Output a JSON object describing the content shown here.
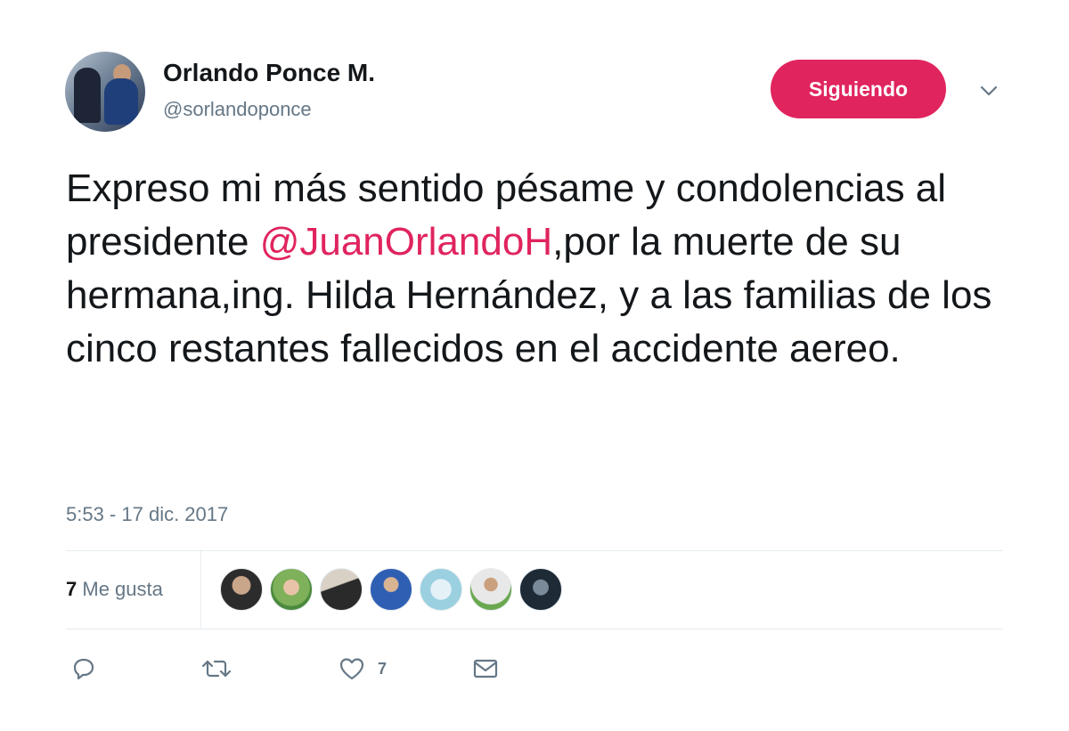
{
  "author": {
    "name": "Orlando Ponce M.",
    "handle": "@sorlandoponce",
    "avatar_icon": "avatar-photo"
  },
  "follow_button": {
    "label": "Siguiendo",
    "color": "#e0245e"
  },
  "more_menu": {
    "icon": "chevron-down-icon"
  },
  "tweet": {
    "text_before": "Expreso mi más sentido pésame y condolencias al presidente ",
    "mention": "@JuanOrlandoH",
    "text_after": ",por la muerte de su hermana,ing. Hilda Hernández, y a las familias de los cinco restantes fallecidos en el accidente aereo.",
    "mention_color": "#e0245e"
  },
  "timestamp": "5:53 - 17 dic. 2017",
  "likes": {
    "count": "7",
    "label": "Me gusta",
    "liker_avatars": [
      "liker-1",
      "liker-2",
      "liker-3",
      "liker-4",
      "liker-5",
      "liker-6",
      "liker-7"
    ]
  },
  "actions": {
    "reply_icon": "reply-icon",
    "retweet_icon": "retweet-icon",
    "like_icon": "heart-icon",
    "like_count": "7",
    "message_icon": "envelope-icon"
  },
  "colors": {
    "text": "#14171a",
    "secondary": "#657786",
    "divider": "#e6ecf0"
  }
}
